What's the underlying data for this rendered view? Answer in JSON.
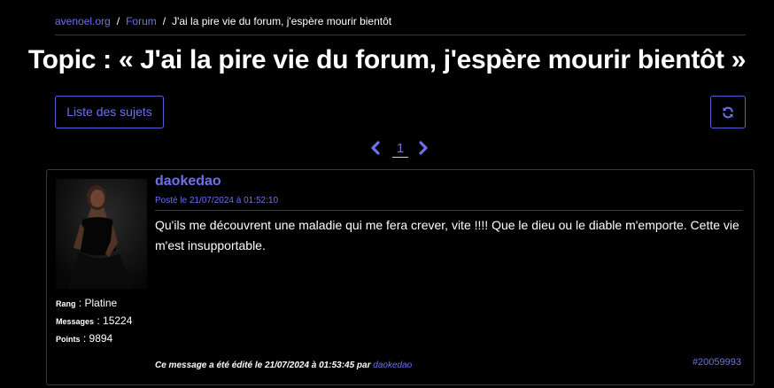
{
  "breadcrumb": {
    "home": "avenoel.org",
    "sep1": "/",
    "forum": "Forum",
    "sep2": "/",
    "current": "J'ai la pire vie du forum, j'espère mourir bientôt"
  },
  "header": {
    "title": "Topic : « J'ai la pire vie du forum, j'espère mourir bientôt »"
  },
  "toolbar": {
    "topics_label": "Liste des sujets",
    "refresh_icon": "refresh-icon"
  },
  "pagination": {
    "current_page": "1",
    "prev_icon": "chevron-left-icon",
    "next_icon": "chevron-right-icon"
  },
  "post": {
    "author": "daokedao",
    "posted": "Posté le 21/07/2024 à 01:52:10",
    "content": "Qu'ils me découvrent une maladie qui me fera crever, vite !!!! Que le dieu ou le diable m'emporte. Cette vie m'est insupportable.",
    "rank_label": "Rang",
    "rank_value": " : Platine",
    "messages_label": "Messages",
    "messages_value": " : 15224",
    "points_label": "Points",
    "points_value": " : 9894",
    "edited_prefix": "Ce message a été édité le 21/07/2024 à 01:53:45 par ",
    "edited_by": "daokedao",
    "id": "#20059993"
  },
  "colors": {
    "accent": "#6d72e8",
    "background": "#000000",
    "border": "#3a3a3a"
  }
}
